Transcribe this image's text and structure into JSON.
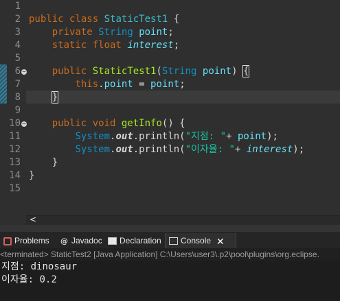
{
  "editor": {
    "line_numbers": [
      "1",
      "2",
      "3",
      "4",
      "5",
      "6",
      "7",
      "8",
      "9",
      "10",
      "11",
      "12",
      "13",
      "14",
      "15"
    ],
    "lines": {
      "l2": {
        "kw": "public class",
        "name": "StaticTest1",
        "rest": " {"
      },
      "l3": {
        "mod": "private",
        "type": "String",
        "field": "point",
        "rest": ";"
      },
      "l4": {
        "kw": "static float",
        "field": "interest",
        "rest": ";"
      },
      "l6": {
        "mod": "public",
        "method": "StaticTest1",
        "paren": "(",
        "type": "String",
        "param": "point",
        ")": ")",
        "brace": "{"
      },
      "l7": {
        "kw": "this",
        "dot": ".",
        "field": "point",
        "rest": " = ",
        "param": "point",
        "end": ";"
      },
      "l8": {
        "brace": "}"
      },
      "l10": {
        "mod": "public void",
        "method": "getInfo",
        "rest": "() {"
      },
      "l11": {
        "class": "System",
        "dot": ".",
        "out": "out",
        "call": ".println(",
        "string": "\"지점: \"",
        "plus": "+ ",
        "field": "point",
        "end": ");"
      },
      "l12": {
        "class": "System",
        "dot": ".",
        "out": "out",
        "call": ".println(",
        "string": "\"이자율: \"",
        "plus": "+ ",
        "field": "interest",
        "end": ");"
      },
      "l13": {
        "brace": "}"
      },
      "l14": {
        "brace": "}"
      }
    }
  },
  "scrollbar": {
    "left_arrow": "<"
  },
  "bottom_panel": {
    "tabs": [
      {
        "label": "Problems",
        "icon": "problems-icon"
      },
      {
        "label": "Javadoc",
        "icon": "javadoc-icon"
      },
      {
        "label": "Declaration",
        "icon": "declaration-icon"
      },
      {
        "label": "Console",
        "icon": "console-icon",
        "active": true
      }
    ],
    "close": "✕",
    "status": "<terminated> StaticTest2 [Java Application] C:\\Users\\user3\\.p2\\pool\\plugins\\org.eclipse.",
    "console_lines": [
      "지점: dinosaur",
      "이자율: 0.2"
    ]
  },
  "colors": {
    "editor_bg": "#2f2f2f",
    "keyword": "#cc6c1d",
    "type": "#1290c3",
    "method": "#a7ec21",
    "field": "#66e1f8",
    "string": "#17c6a3"
  }
}
